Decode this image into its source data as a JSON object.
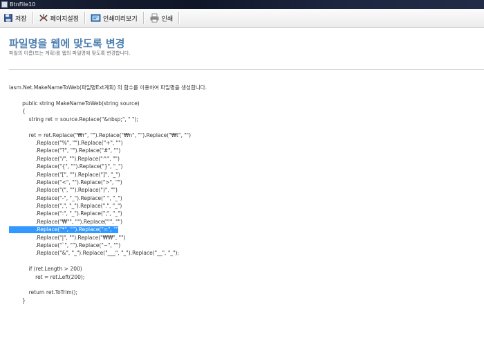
{
  "window": {
    "title": "BtnFile10"
  },
  "toolbar": {
    "buttons": [
      {
        "label": "저장",
        "icon": "floppy-disk-icon"
      },
      {
        "label": "페이지설정",
        "icon": "page-setup-icon"
      },
      {
        "label": "인쇄미리보기",
        "icon": "print-preview-icon"
      },
      {
        "label": "인쇄",
        "icon": "printer-icon"
      }
    ]
  },
  "page": {
    "title": "파일명을 웹에 맞도록 변경",
    "subtitle": "파일의 이름(또는 계획)를 웹의 파일명에 맞도록 변경합니다.",
    "intro": "iasm.Net.MakeNameToWeb(파일명Ext계획) 의 함수를 이용하여 파일명을 생성합니다.",
    "selected_line_index": 16,
    "code_lines": [
      "        public string MakeNameToWeb(string source)",
      "        {",
      "            string ret = source.Replace(\"&nbsp;\", \" \");",
      "",
      "            ret = ret.Replace(\"₩r\", \"\").Replace(\"₩n\", \"\").Replace(\"₩t\", \"\")",
      "                .Replace(\"%\", \"\").Replace(\"+\", \"\")",
      "                .Replace(\"?\", \"\").Replace(\"#\", \"\")",
      "                .Replace(\"/\", \"\").Replace(\"^\", \"\")",
      "                .Replace(\"{\", \"\").Replace(\"}\", \"_\")",
      "                .Replace(\"[\", \"\").Replace(\"]\", \"_\")",
      "                .Replace(\"<\", \"\").Replace(\">\", \"\")",
      "                .Replace(\"(\", \"\").Replace(\")\", \"\")",
      "                .Replace(\"-\", \"_\").Replace(\" \", \"_\")",
      "                .Replace(\",\", \"_\").Replace(\".\", \"_\")",
      "                .Replace(\":\", \"_\").Replace(\";\", \"_\")",
      "                .Replace(\"₩\"\", \"\").Replace(\"'\", \"\")",
      "                .Replace(\"*\", \"\").Replace(\"=\", \"\")",
      "                .Replace(\"|\", \"\").Replace(\"₩₩\", \"\")",
      "                .Replace(\"`\", \"\").Replace(\"~\", \"\")",
      "                .Replace(\"&\", \"_\").Replace(\"___\", \"_\").Replace(\"__\", \"_\");",
      "",
      "            if (ret.Length > 200)",
      "                ret = ret.Left(200);",
      "",
      "            return ret.ToTrim();",
      "        }"
    ]
  }
}
